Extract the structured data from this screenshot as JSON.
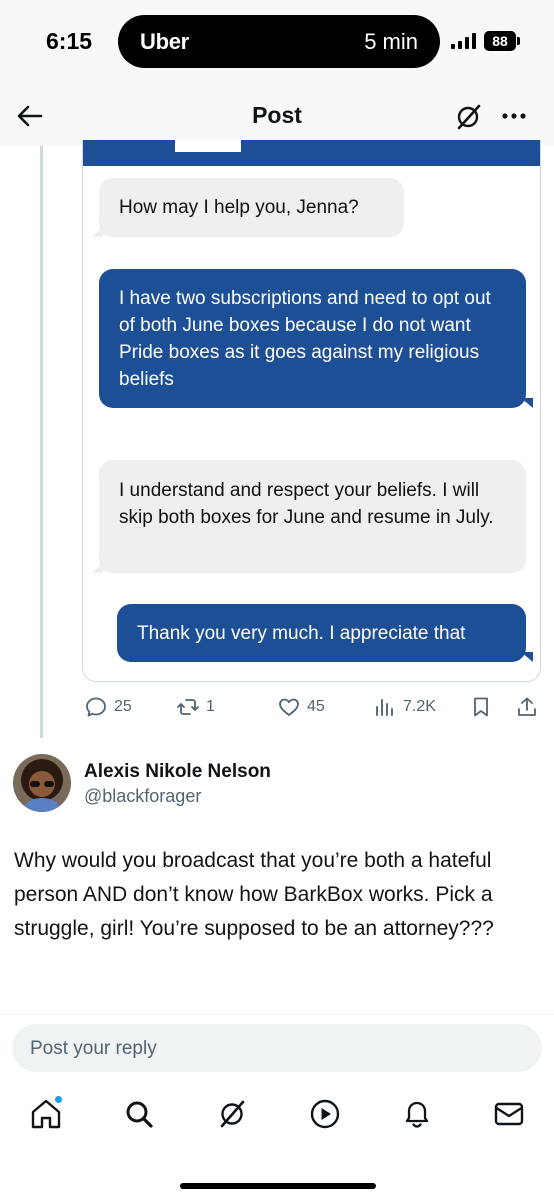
{
  "status_bar": {
    "time": "6:15",
    "live_activity_app": "Uber",
    "live_activity_eta": "5 min",
    "battery": "88"
  },
  "header": {
    "title": "Post"
  },
  "quoted_image": {
    "messages": [
      {
        "from": "agent",
        "text": "How may I help you, Jenna?"
      },
      {
        "from": "user",
        "text": "I have two subscriptions and need to opt out of both June boxes because I do not want Pride boxes as it goes against my religious beliefs"
      },
      {
        "from": "agent",
        "text": "I understand and respect your beliefs. I will skip both boxes for June and resume in July."
      },
      {
        "from": "user",
        "text": "Thank you very much. I appreciate that"
      }
    ],
    "colors": {
      "outgoing": "#1c4f95",
      "incoming": "#efefef"
    }
  },
  "actions": {
    "replies": "25",
    "reposts": "1",
    "likes": "45",
    "views": "7.2K"
  },
  "reply": {
    "author_name": "Alexis Nikole Nelson",
    "author_handle": "@blackforager",
    "text": "Why would you broadcast that you’re both a hateful person AND don’t know how BarkBox works. Pick a struggle, girl! You’re supposed to be an attorney???"
  },
  "composer": {
    "placeholder": "Post your reply"
  },
  "bottom_nav": {
    "items": [
      "home-icon",
      "search-icon",
      "grok-icon",
      "video-icon",
      "notifications-icon",
      "messages-icon"
    ],
    "has_notification_dot": true
  }
}
